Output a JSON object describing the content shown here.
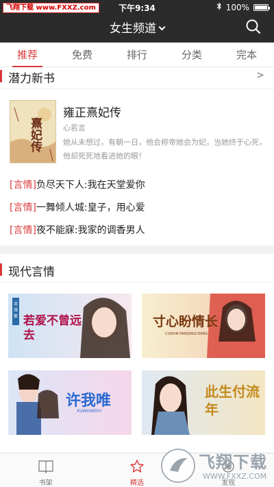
{
  "watermark": "飞翔下载 www.FXXZ.com",
  "status": {
    "time": "下午9:34",
    "battery": "100%"
  },
  "header": {
    "title": "女生频道"
  },
  "tabs": [
    {
      "label": "推荐"
    },
    {
      "label": "免费"
    },
    {
      "label": "排行"
    },
    {
      "label": "分类"
    },
    {
      "label": "完本"
    }
  ],
  "section_new": {
    "title": "潜力新书",
    "more": ">",
    "featured": {
      "cover_text": "熹妃传",
      "title": "雍正熹妃传",
      "author": "心若言",
      "desc": "她从未想过，有朝一日，他会称帝她会为妃，当她终于心死，他却死死地看进她的眼！"
    },
    "recommendations": [
      {
        "tag": "[言情]",
        "text": "负尽天下人:我在天堂爱你"
      },
      {
        "tag": "[言情]",
        "text": "一舞倾人城:皇子，用心爱"
      },
      {
        "tag": "[言情]",
        "text": "夜不能寐:我家的调香男人"
      }
    ]
  },
  "section_modern": {
    "title": "现代言情",
    "banners": [
      {
        "title": "若爱不曾远去",
        "sub": "流潋紫",
        "colors": [
          "#cfe3f5",
          "#f6e7ee"
        ]
      },
      {
        "title": "寸心盼情长",
        "sub": "CUNXIN PANQINGCHANG",
        "colors": [
          "#f7efcf",
          "#d94b3f"
        ]
      },
      {
        "title": "许我唯",
        "sub": "XUWOWEIYI",
        "colors": [
          "#dbe6f7",
          "#f7d6ea"
        ]
      },
      {
        "title": "此生付流年",
        "sub": "",
        "colors": [
          "#dfe8f2",
          "#f3e6c2"
        ]
      }
    ]
  },
  "bottom_nav": [
    {
      "label": "书架",
      "icon": "book-icon"
    },
    {
      "label": "精选",
      "icon": "star-icon"
    },
    {
      "label": "发现",
      "icon": "compass-icon"
    }
  ],
  "ad_watermark": {
    "brand": "飞翔下载",
    "url": "WWW.FXXZ.COM"
  },
  "colors": {
    "accent": "#d8393b",
    "header_bg": "#2b2b2b"
  }
}
